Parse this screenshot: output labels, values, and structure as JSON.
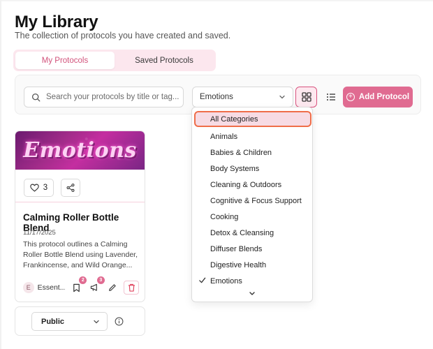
{
  "header": {
    "title": "My Library",
    "subtitle": "The collection of protocols you have created and saved."
  },
  "tabs": [
    {
      "label": "My Protocols",
      "active": true
    },
    {
      "label": "Saved Protocols",
      "active": false
    }
  ],
  "toolbar": {
    "search_placeholder": "Search your protocols by title or tag...",
    "category_value": "Emotions",
    "add_label": "Add Protocol",
    "active_view": "grid"
  },
  "card": {
    "banner_text": "Emotions",
    "likes": "3",
    "title": "Calming Roller Bottle Blend",
    "date": "11/17/2025",
    "description": "This protocol outlines a Calming Roller Bottle Blend using Lavender, Frankincense, and Wild Orange...",
    "author_initial": "E",
    "author_name": "Essent...",
    "bookmark_count": "2",
    "comment_count": "3",
    "visibility": "Public"
  },
  "dropdown": {
    "items": [
      "All Categories",
      "Animals",
      "Babies & Children",
      "Body Systems",
      "Cleaning & Outdoors",
      "Cognitive & Focus Support",
      "Cooking",
      "Detox & Cleansing",
      "Diffuser Blends",
      "Digestive Health",
      "Emotions"
    ],
    "highlighted": "All Categories",
    "checked": "Emotions"
  },
  "colors": {
    "accent": "#e06b91",
    "accent_light": "#fce7ee",
    "highlight_border": "#ef6e4a"
  },
  "icons": [
    "search-icon",
    "chevron-down-icon",
    "grid-icon",
    "list-icon",
    "plus-circle-icon",
    "heart-icon",
    "share-icon",
    "bookmark-icon",
    "megaphone-icon",
    "pencil-icon",
    "trash-icon",
    "info-icon",
    "check-icon"
  ]
}
